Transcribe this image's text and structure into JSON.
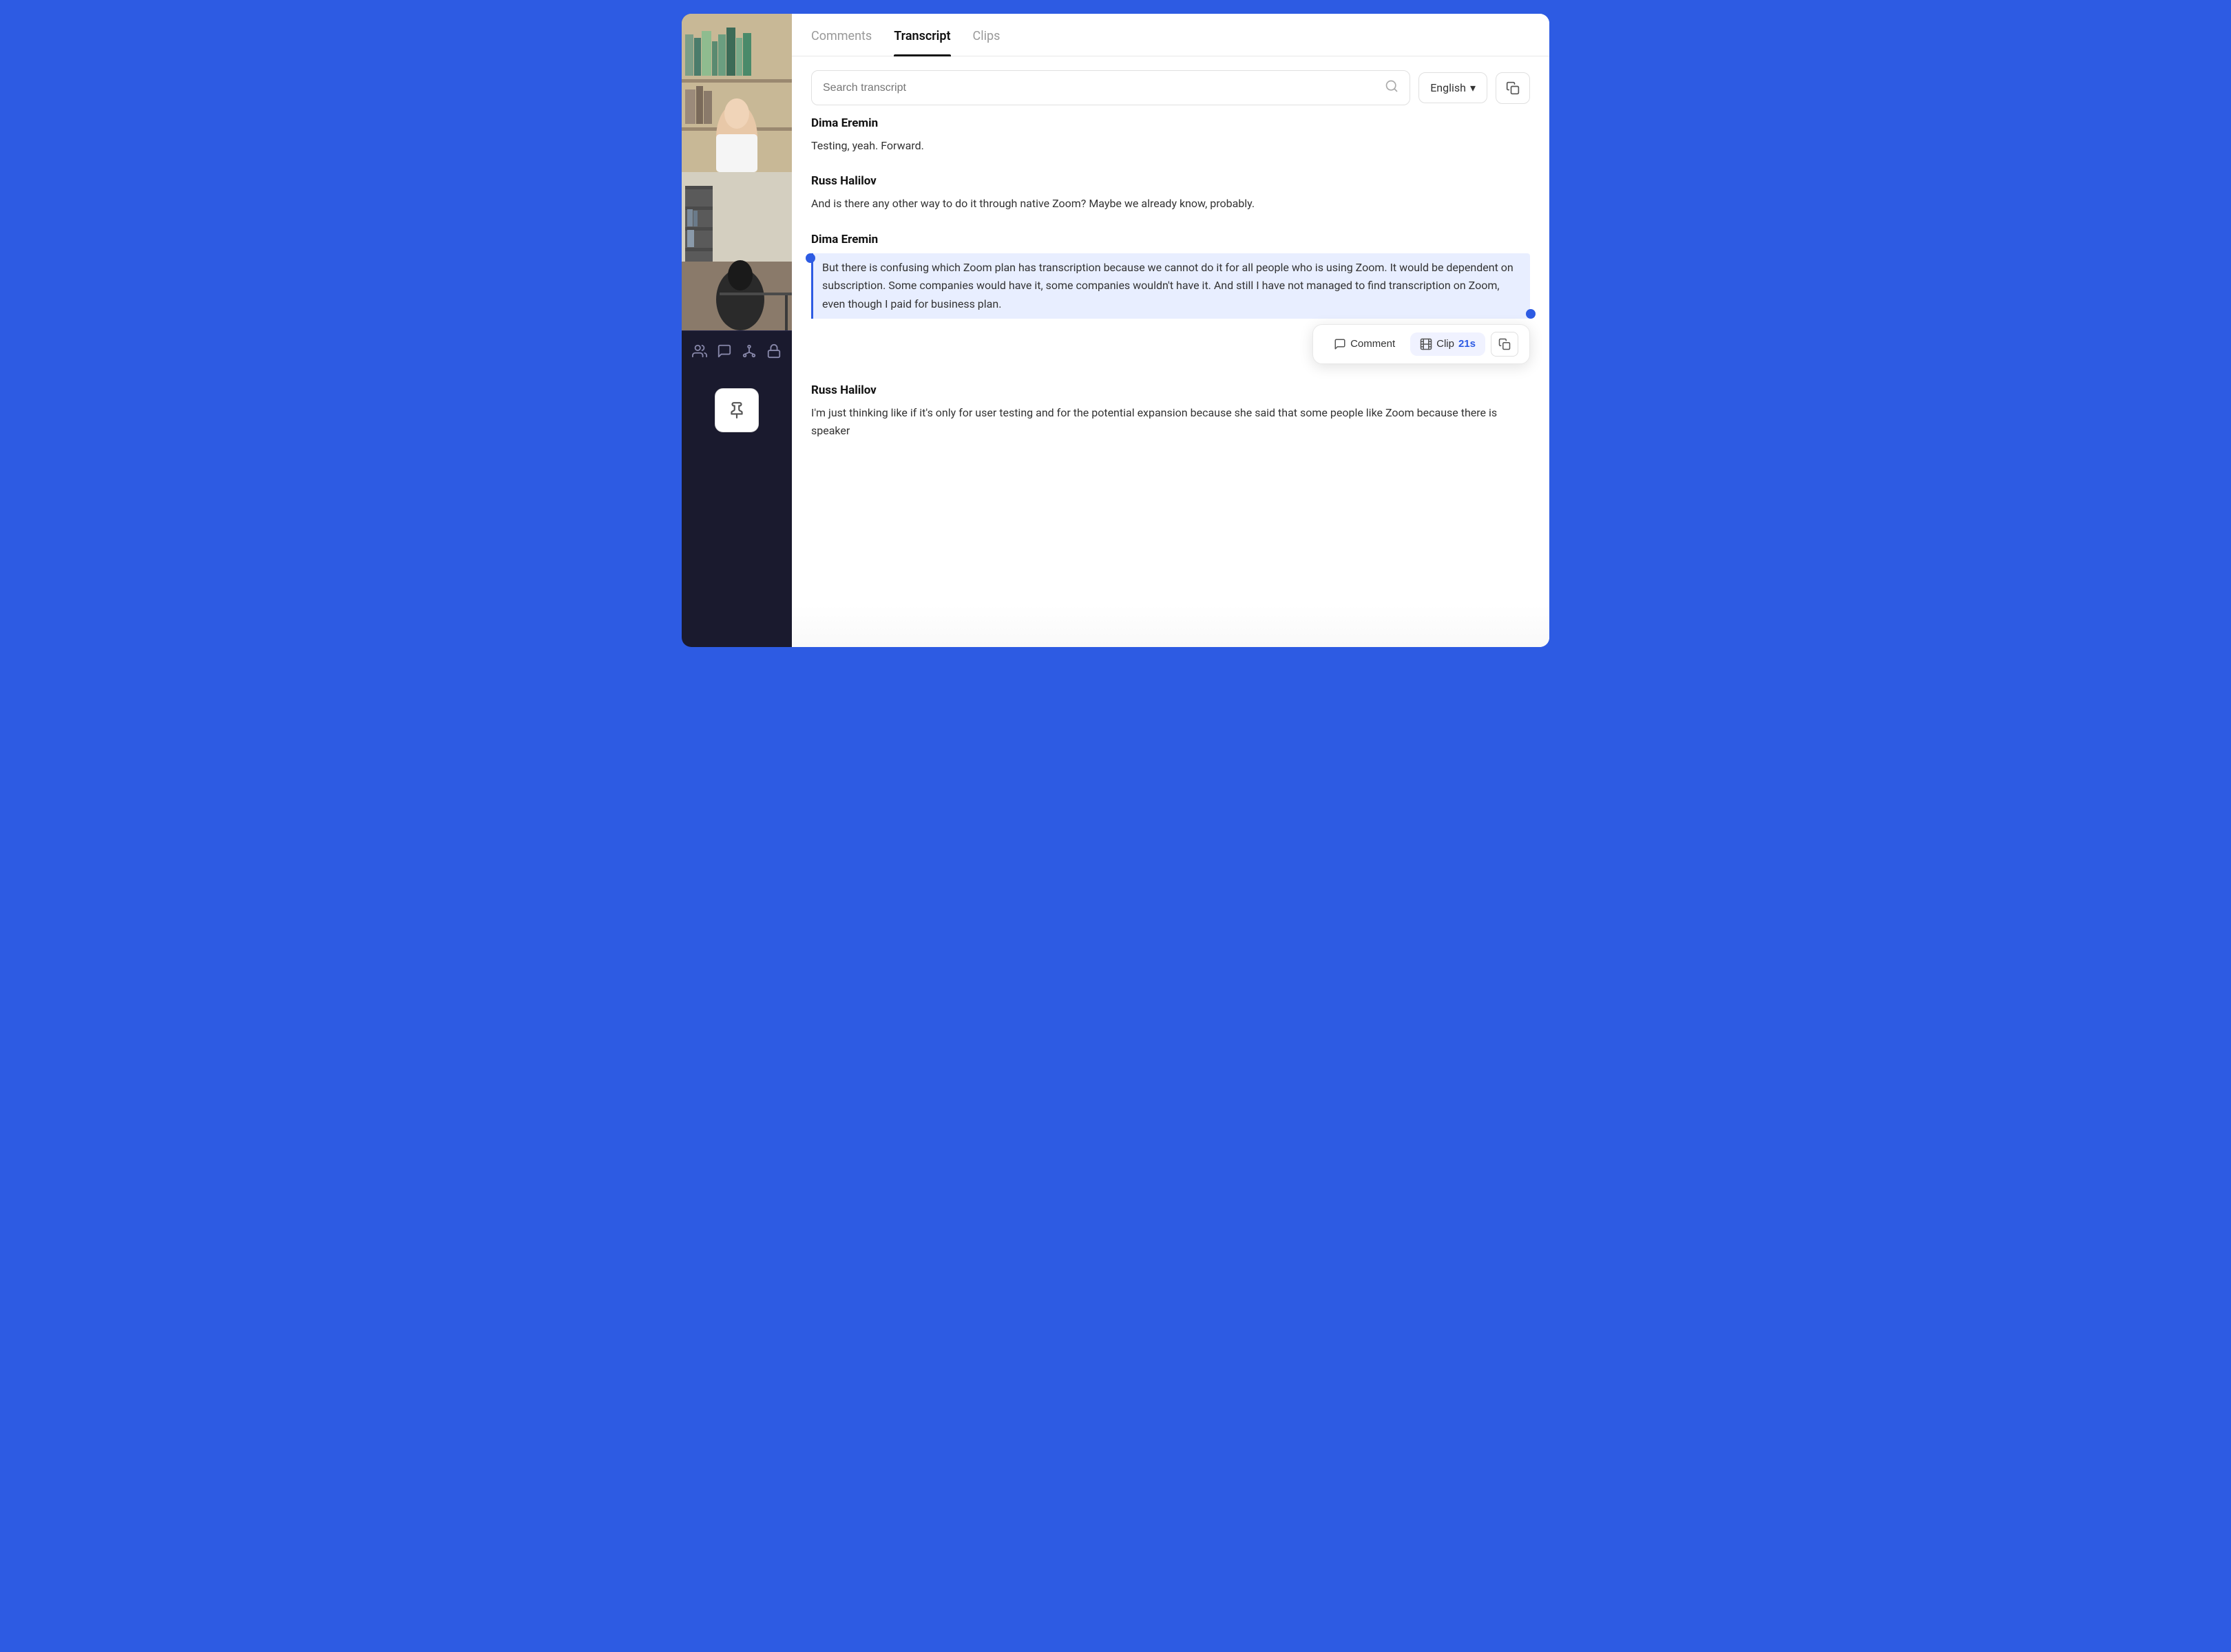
{
  "background_color": "#2d5be3",
  "tabs": {
    "items": [
      {
        "label": "Comments",
        "id": "comments",
        "active": false
      },
      {
        "label": "Transcript",
        "id": "transcript",
        "active": true
      },
      {
        "label": "Clips",
        "id": "clips",
        "active": false
      }
    ]
  },
  "search": {
    "placeholder": "Search transcript",
    "value": ""
  },
  "language": {
    "label": "English",
    "dropdown_icon": "▾"
  },
  "transcript": {
    "entries": [
      {
        "id": "entry-1",
        "speaker": "Dima Eremin",
        "text": "Testing, yeah. Forward.",
        "highlighted": false
      },
      {
        "id": "entry-2",
        "speaker": "Russ Halilov",
        "text": "And is there any other way to do it through native Zoom? Maybe we already know, probably.",
        "highlighted": false
      },
      {
        "id": "entry-3",
        "speaker": "Dima Eremin",
        "text": "But there is confusing which Zoom plan has transcription because we cannot do it for all people who is using Zoom. It would be dependent on subscription. Some companies would have it, some companies wouldn't have it. And still I have not managed to find transcription on Zoom, even though I paid for business plan.",
        "highlighted": true
      },
      {
        "id": "entry-4",
        "speaker": "Russ Halilov",
        "text": "I'm just thinking like if it's only for user testing and for the potential expansion because she said that some people like Zoom because there is speaker",
        "highlighted": false
      }
    ]
  },
  "action_toolbar": {
    "comment_label": "Comment",
    "clip_label": "Clip",
    "clip_time": "21s",
    "comment_icon": "💬",
    "clip_icon": "🎬"
  },
  "icons": {
    "search": "⌕",
    "copy": "⧉",
    "chevron_down": "▾",
    "users": "👥",
    "chat": "💬",
    "tree": "⬡",
    "lock": "🔒",
    "pin": "📌"
  }
}
